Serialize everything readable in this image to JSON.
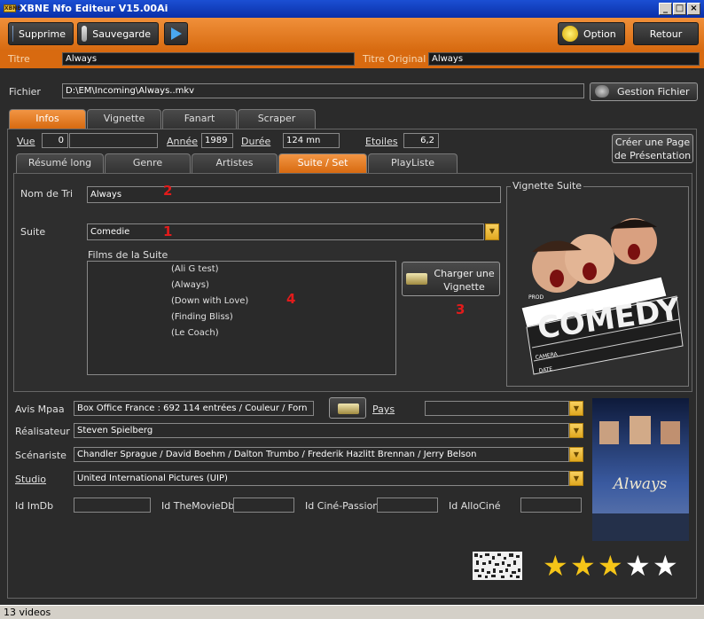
{
  "window": {
    "title": "XBNE Nfo Editeur V15.00Ai",
    "icon_text": "XBNE"
  },
  "toolbar": {
    "supprime": "Supprime",
    "sauvegarde": "Sauvegarde",
    "option": "Option",
    "retour": "Retour"
  },
  "titles": {
    "titre_label": "Titre",
    "titre_value": "Always",
    "titre_original_label": "Titre Original",
    "titre_original_value": "Always"
  },
  "fichier": {
    "label": "Fichier",
    "value": "D:\\EM\\Incoming\\Always..mkv",
    "button": "Gestion Fichier"
  },
  "main_tabs": [
    "Infos",
    "Vignette",
    "Fanart",
    "Scraper"
  ],
  "info_row": {
    "vue_label": "Vue",
    "vue_value": "0",
    "annee_label": "Année",
    "annee_value": "1989",
    "duree_label": "Durée",
    "duree_value": "124 mn",
    "etoiles_label": "Etoiles",
    "etoiles_value": "6,2",
    "page_button": "Créer une Page de Présentation"
  },
  "sub_tabs": [
    "Résumé long",
    "Genre",
    "Artistes",
    "Suite / Set",
    "PlayListe"
  ],
  "suite": {
    "nom_tri_label": "Nom de Tri",
    "nom_tri_value": "Always",
    "suite_label": "Suite",
    "suite_value": "Comedie",
    "films_label": "Films de la Suite",
    "films": [
      "(Ali G test)",
      "(Always)",
      "(Down with Love)",
      "(Finding Bliss)",
      "(Le Coach)"
    ],
    "charger_button": "Charger une Vignette",
    "vignette_label": "Vignette Suite",
    "vignette_text": "COMEDY",
    "clapper_prod": "PROD",
    "clapper_camera": "CAMERA",
    "clapper_date": "DATE",
    "markers": [
      "2",
      "1",
      "4",
      "3"
    ]
  },
  "details": {
    "mpaa_label": "Avis Mpaa",
    "mpaa_value": "Box Office France : 692 114 entrées / Couleur / Forn",
    "pays_label": "Pays",
    "pays_value": "",
    "realisateur_label": "Réalisateur",
    "realisateur_value": "Steven Spielberg",
    "scenariste_label": "Scénariste",
    "scenariste_value": "Chandler Sprague / David Boehm / Dalton Trumbo / Frederik Hazlitt Brennan / Jerry Belson",
    "studio_label": "Studio",
    "studio_value": "United International Pictures (UIP)",
    "id_imdb_label": "Id ImDb",
    "id_tmdb_label": "Id TheMovieDb",
    "id_cine_label": "Id Ciné-Passion",
    "id_allo_label": "Id AlloCiné",
    "poster_title": "Always"
  },
  "rating": {
    "stars_filled": 3,
    "stars_total": 5
  },
  "status": {
    "text": "13 videos"
  },
  "colors": {
    "accent": "#e07a1f",
    "dark": "#2b2b2b",
    "star": "#f5c518"
  }
}
